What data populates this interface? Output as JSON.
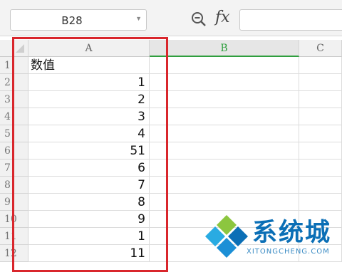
{
  "formula_bar": {
    "name_box_value": "B28",
    "fx_label": "fx",
    "formula_value": ""
  },
  "columns": [
    "A",
    "B",
    "C"
  ],
  "rows": [
    {
      "num": "1",
      "a": "数值",
      "kind": "text"
    },
    {
      "num": "2",
      "a": "1",
      "kind": "num"
    },
    {
      "num": "3",
      "a": "2",
      "kind": "num"
    },
    {
      "num": "4",
      "a": "3",
      "kind": "num"
    },
    {
      "num": "5",
      "a": "4",
      "kind": "num"
    },
    {
      "num": "6",
      "a": "51",
      "kind": "num"
    },
    {
      "num": "7",
      "a": "6",
      "kind": "num"
    },
    {
      "num": "8",
      "a": "7",
      "kind": "num"
    },
    {
      "num": "9",
      "a": "8",
      "kind": "num"
    },
    {
      "num": "10",
      "a": "9",
      "kind": "num"
    },
    {
      "num": "11",
      "a": "1",
      "kind": "num"
    },
    {
      "num": "12",
      "a": "11",
      "kind": "num"
    }
  ],
  "selected_column": "B",
  "colors": {
    "highlight": "#d9262c",
    "selected_column_accent": "#2f9e3e",
    "watermark": "#0b6fb6"
  },
  "watermark": {
    "title": "系统城",
    "subtitle": "XITONGCHENG.COM"
  }
}
